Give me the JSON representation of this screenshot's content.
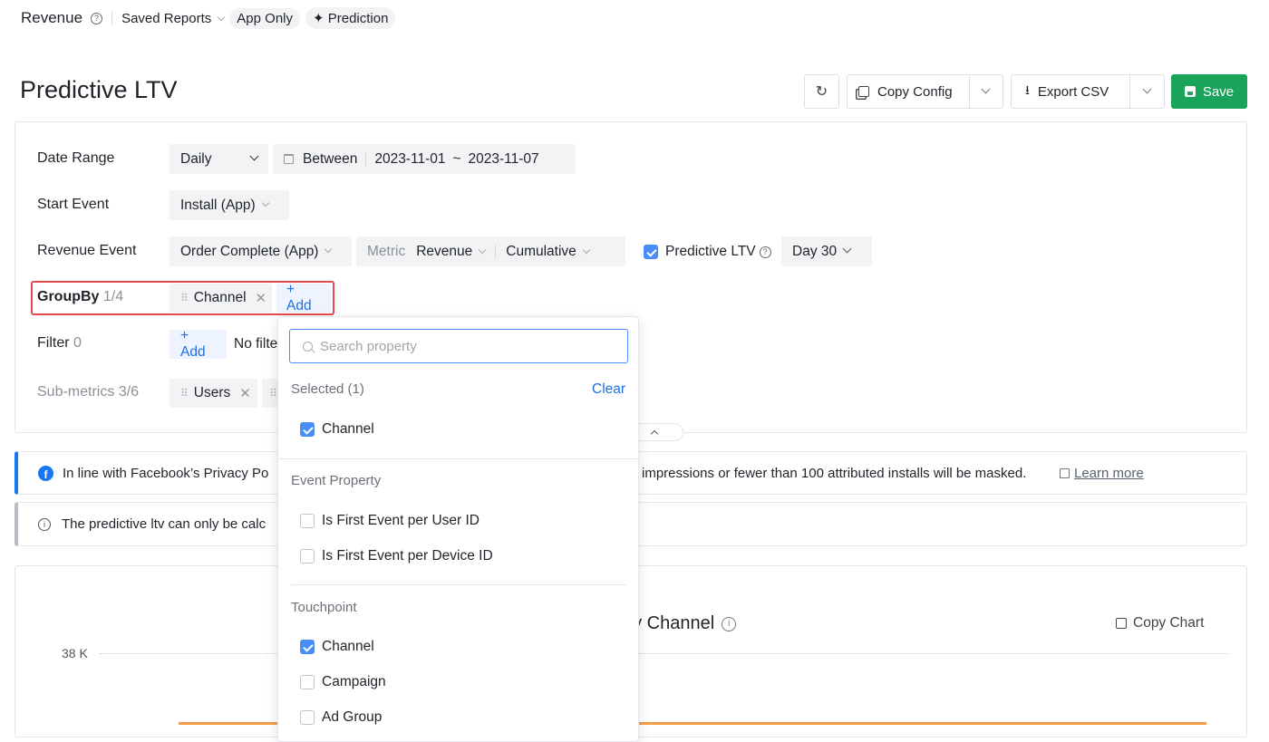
{
  "topbar": {
    "title": "Revenue",
    "saved_reports": "Saved Reports",
    "app_only": "App Only",
    "prediction": "Prediction"
  },
  "page": {
    "title": "Predictive LTV"
  },
  "actions": {
    "copy_config": "Copy Config",
    "export_csv": "Export CSV",
    "save": "Save"
  },
  "config": {
    "date_range": {
      "label": "Date Range",
      "granularity": "Daily",
      "operator": "Between",
      "start": "2023-11-01",
      "sep": "~",
      "end": "2023-11-07"
    },
    "start_event": {
      "label": "Start Event",
      "value": "Install (App)"
    },
    "revenue_event": {
      "label": "Revenue Event",
      "value": "Order Complete (App)",
      "metric_label": "Metric",
      "metric_value": "Revenue",
      "mode": "Cumulative",
      "predictive_label": "Predictive LTV",
      "predictive_checked": true,
      "day": "Day 30"
    },
    "groupby": {
      "label": "GroupBy",
      "count": "1/4",
      "chip": "Channel",
      "add": "+ Add"
    },
    "filter": {
      "label": "Filter",
      "count": "0",
      "add": "+ Add",
      "none_text": "No filte"
    },
    "submetrics": {
      "label": "Sub-metrics",
      "count": "3/6",
      "chip": "Users"
    }
  },
  "notices": {
    "facebook_left": "In line with Facebook’s Privacy Po",
    "facebook_right": "impressions or fewer than 100 attributed installs will be masked.",
    "learn_more": "Learn more",
    "predictive_info": "The predictive ltv can only be calc"
  },
  "chart": {
    "title_fragment": "by Channel",
    "copy_chart": "Copy Chart",
    "y_tick": "38 K",
    "line_color": "#f39c45"
  },
  "dropdown": {
    "search_placeholder": "Search property",
    "selected_label": "Selected (1)",
    "clear": "Clear",
    "selected_items": [
      {
        "label": "Channel",
        "checked": true
      }
    ],
    "event_property_label": "Event Property",
    "event_property_items": [
      {
        "label": "Is First Event per User ID",
        "checked": false
      },
      {
        "label": "Is First Event per Device ID",
        "checked": false
      }
    ],
    "touchpoint_label": "Touchpoint",
    "touchpoint_items": [
      {
        "label": "Channel",
        "checked": true
      },
      {
        "label": "Campaign",
        "checked": false
      },
      {
        "label": "Ad Group",
        "checked": false
      }
    ]
  },
  "colors": {
    "accent": "#1f6fe5",
    "save": "#1aa35a",
    "highlight": "#e5484d",
    "facebook": "#1877f2"
  }
}
